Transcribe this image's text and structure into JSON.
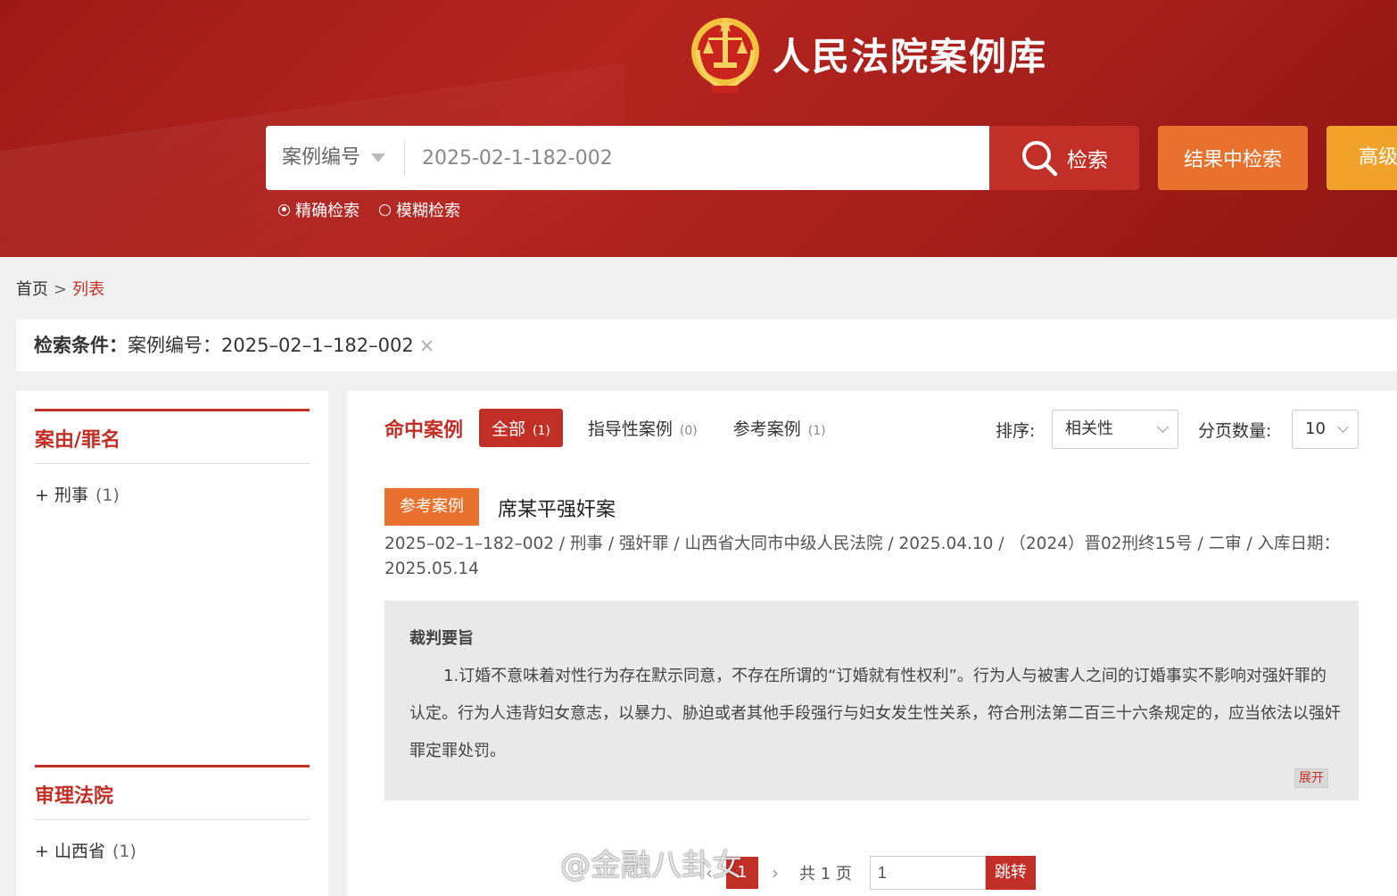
{
  "header": {
    "site_title": "人民法院案例库",
    "search": {
      "type_label": "案例编号",
      "query": "2025-02-1-182-002",
      "search_button": "检索",
      "in_result_button": "结果中检索",
      "advanced_button": "高级"
    },
    "modes": [
      {
        "label": "精确检索",
        "selected": true
      },
      {
        "label": "模糊检索",
        "selected": false
      }
    ]
  },
  "breadcrumb": {
    "home": "首页",
    "separator": ">",
    "current": "列表"
  },
  "condition": {
    "label": "检索条件：",
    "text": "案例编号：2025–02–1–182–002",
    "remove": "×"
  },
  "sidebar": {
    "sections": [
      {
        "title": "案由/罪名",
        "item": "+ 刑事",
        "count": "(1)"
      },
      {
        "title": "审理法院",
        "item": "+ 山西省",
        "count": "(1)"
      }
    ]
  },
  "main": {
    "heading": "命中案例",
    "tabs": [
      {
        "label": "全部",
        "count": "(1)"
      },
      {
        "label": "指导性案例",
        "count": "(0)"
      },
      {
        "label": "参考案例",
        "count": "(1)"
      }
    ],
    "sort_label": "排序:",
    "sort_value": "相关性",
    "page_size_label": "分页数量:",
    "page_size_value": "10",
    "result": {
      "badge": "参考案例",
      "title": "席某平强奸案",
      "meta": "2025–02–1–182–002 / 刑事 / 强奸罪 / 山西省大同市中级人民法院 / 2025.04.10 / （2024）晋02刑终15号 / 二审 / 入库日期：2025.05.14",
      "summary_heading": "裁判要旨",
      "summary_text": "1.订婚不意味着对性行为存在默示同意，不存在所谓的“订婚就有性权利”。行为人与被害人之间的订婚事实不影响对强奸罪的认定。行为人违背妇女意志，以暴力、胁迫或者其他手段强行与妇女发生性关系，符合刑法第二百三十六条规定的，应当依法以强奸罪定罪处罚。",
      "expand": "展开"
    }
  },
  "pagination": {
    "prev": "‹",
    "current": "1",
    "next": "›",
    "total": "共 1 页",
    "jump_value": "1",
    "jump_button": "跳转"
  },
  "watermark": "@金融八卦女",
  "colors": {
    "brand_red": "#c22f27",
    "orange": "#e8712e",
    "gold": "#f0a22b"
  }
}
